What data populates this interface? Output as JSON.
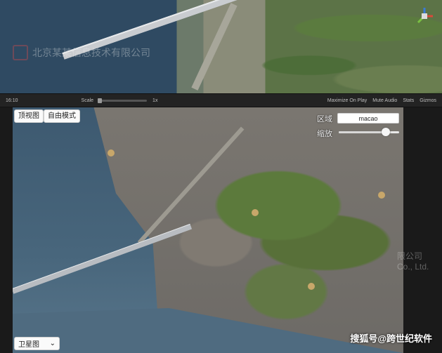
{
  "scene_view": {
    "watermark_text": "北京某某信息技术有限公司",
    "gizmo_icon": "axis-gizmo-icon"
  },
  "toolbar": {
    "display": "16:10",
    "scale_label": "Scale",
    "scale_value": "1x",
    "maximize_on_play": "Maximize On Play",
    "mute_audio": "Mute Audio",
    "stats": "Stats",
    "gizmos": "Gizmos"
  },
  "map_controls": {
    "top_view_button": "顶视图",
    "free_mode_button": "自由模式",
    "region_label": "区域",
    "region_value": "macao",
    "zoom_label": "缩放",
    "zoom_level": 0.78,
    "map_type_value": "卫星图"
  },
  "watermarks": {
    "company_partial": "限公司",
    "company_partial_en": "Co., Ltd.",
    "credit": "搜狐号@跨世纪软件"
  },
  "colors": {
    "accent_red": "#e04a4a",
    "button_bg": "#fafafa",
    "toolbar_bg": "#232323"
  }
}
